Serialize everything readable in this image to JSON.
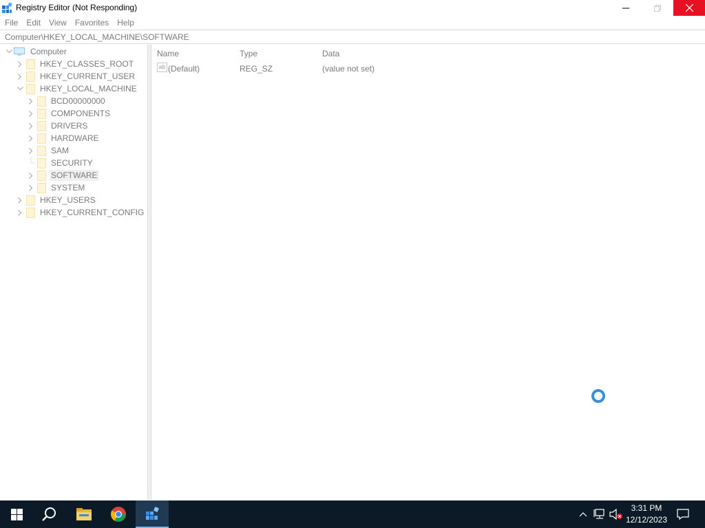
{
  "window": {
    "title": "Registry Editor (Not Responding)",
    "icon": "regedit-icon"
  },
  "menu": [
    "File",
    "Edit",
    "View",
    "Favorites",
    "Help"
  ],
  "address": "Computer\\HKEY_LOCAL_MACHINE\\SOFTWARE",
  "tree": {
    "root": "Computer",
    "items": [
      {
        "label": "HKEY_CLASSES_ROOT",
        "expanded": false
      },
      {
        "label": "HKEY_CURRENT_USER",
        "expanded": false
      },
      {
        "label": "HKEY_LOCAL_MACHINE",
        "expanded": true
      },
      {
        "label": "BCD00000000",
        "expanded": false
      },
      {
        "label": "COMPONENTS",
        "expanded": false
      },
      {
        "label": "DRIVERS",
        "expanded": false
      },
      {
        "label": "HARDWARE",
        "expanded": false
      },
      {
        "label": "SAM",
        "expanded": false
      },
      {
        "label": "SECURITY",
        "expanded": false
      },
      {
        "label": "SOFTWARE",
        "expanded": false,
        "selected": true
      },
      {
        "label": "SYSTEM",
        "expanded": false
      },
      {
        "label": "HKEY_USERS",
        "expanded": false
      },
      {
        "label": "HKEY_CURRENT_CONFIG",
        "expanded": false
      }
    ]
  },
  "list": {
    "columns": [
      "Name",
      "Type",
      "Data"
    ],
    "rows": [
      {
        "name": "(Default)",
        "type": "REG_SZ",
        "data": "(value not set)",
        "icon": "string-value-icon"
      }
    ]
  },
  "taskbar": {
    "apps": [
      "start-icon",
      "search-icon",
      "file-explorer-icon",
      "chrome-icon",
      "regedit-icon"
    ],
    "active_app": "regedit-icon",
    "time": "3:31 PM",
    "date": "12/12/2023"
  },
  "colors": {
    "close_button": "#e81123",
    "taskbar": "#0b1a26",
    "busy_cursor": "#3a8fd9",
    "folder": "#fff5d6"
  }
}
